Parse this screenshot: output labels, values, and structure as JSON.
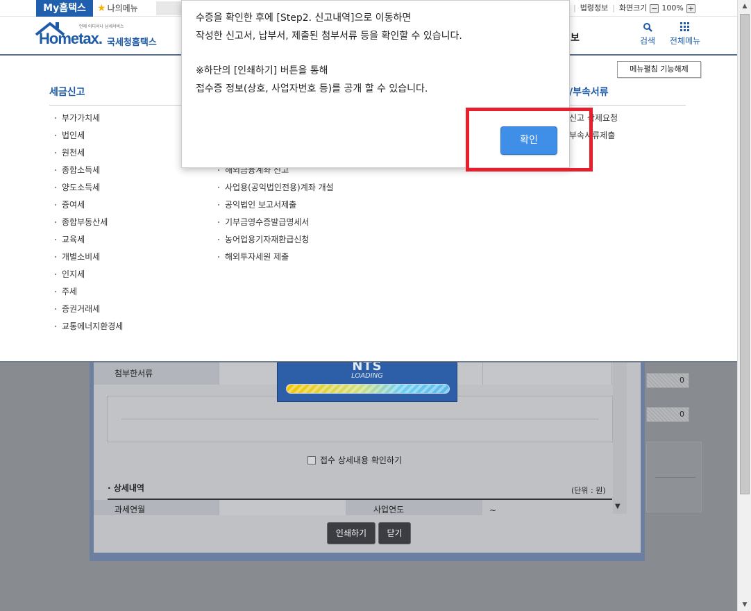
{
  "topbar": {
    "my_hometax": "My홈택스",
    "my_menu": "나의메뉴",
    "links": [
      "법령정보",
      "화면크기"
    ],
    "zoom": "100%",
    "zoom_minus": "−",
    "zoom_plus": "+"
  },
  "header": {
    "logo_tagline": "언제 어디서나 납세서비스",
    "logo_brand": "Hometax.",
    "logo_brand_kr": "국세청홈택스",
    "partial_nav": "보",
    "search": "검색",
    "all_menu": "전체메뉴"
  },
  "menu_panel": {
    "fold_button": "메뉴펼침 기능해제",
    "col1_title": "세금신고",
    "col1_items": [
      "부가가치세",
      "법인세",
      "원천세",
      "종합소득세",
      "양도소득세",
      "증여세",
      "종합부동산세",
      "교육세",
      "개별소비세",
      "인지세",
      "주세",
      "증권거래세",
      "교통에너지환경세"
    ],
    "col2_items": [
      "해외금융계좌 신고",
      "사업용(공익법인전용)계좌 개설",
      "공익법인 보고서제출",
      "기부금영수증발급명세서",
      "농어업용기자재환급신청",
      "해외투자세원 제출"
    ],
    "col4_title": "/부속서류",
    "col4_items": [
      "신고 삭제요청",
      "부속서류제출"
    ]
  },
  "background_dialog": {
    "attach_label": "첨부한서류",
    "field_values": [
      "0",
      "0"
    ],
    "detail_check_label": "접수 상세내용 확인하기",
    "detail_title": "상세내역",
    "unit": "(단위 : 원)",
    "tax_period_label": "과세연월",
    "business_year_label": "사업연도",
    "business_year_value": "~",
    "print_button": "인쇄하기",
    "close_button": "닫기"
  },
  "loading": {
    "title": "NTS",
    "text": "LOADING"
  },
  "alert": {
    "lines": [
      "수증을 확인한 후에 [Step2. 신고내역]으로 이동하면",
      "작성한 신고서, 납부서, 제출된 첨부서류 등을 확인할 수 있습니다.",
      "※하단의 [인쇄하기] 버튼을 통해",
      "접수증 정보(상호, 사업자번호 등)를 공개 할 수 있습니다."
    ],
    "confirm_button": "확인"
  },
  "colors": {
    "brand_blue": "#1d5aa8",
    "confirm_blue": "#3f8ee8",
    "highlight_red": "#e81e2d"
  }
}
